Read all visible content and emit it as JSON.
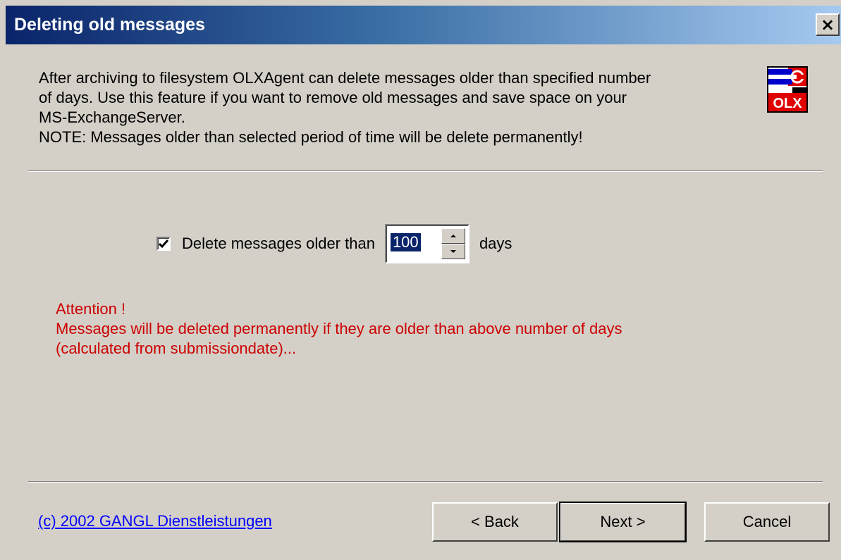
{
  "window": {
    "title": "Deleting old messages",
    "close_label": "×"
  },
  "intro": {
    "lines": [
      "After archiving to filesystem OLXAgent can delete messages older than specified number",
      "of days. Use this feature if you want to remove old messages and save space on your",
      "MS-ExchangeServer.",
      "NOTE: Messages older than selected period of time will be delete permanently!"
    ]
  },
  "logo": {
    "text": "OLX",
    "icon": "olx-agent-logo"
  },
  "option": {
    "checked": true,
    "label": "Delete messages older than",
    "value": "100",
    "unit": "days"
  },
  "attention": {
    "heading": "Attention !",
    "lines": [
      "Messages will be deleted permanently if they are older than above number of days",
      "(calculated from submissiondate)..."
    ]
  },
  "footer": {
    "copyright": "(c) 2002 GANGL Dienstleistungen"
  },
  "buttons": {
    "back": "< Back",
    "next": "Next >",
    "cancel": "Cancel"
  },
  "colors": {
    "title_gradient_start": "#0a246a",
    "title_gradient_end": "#a6caf0",
    "dialog_bg": "#d4d0c8",
    "attention_text": "#cc0000",
    "link": "#0000ff",
    "selection": "#0a246a"
  }
}
